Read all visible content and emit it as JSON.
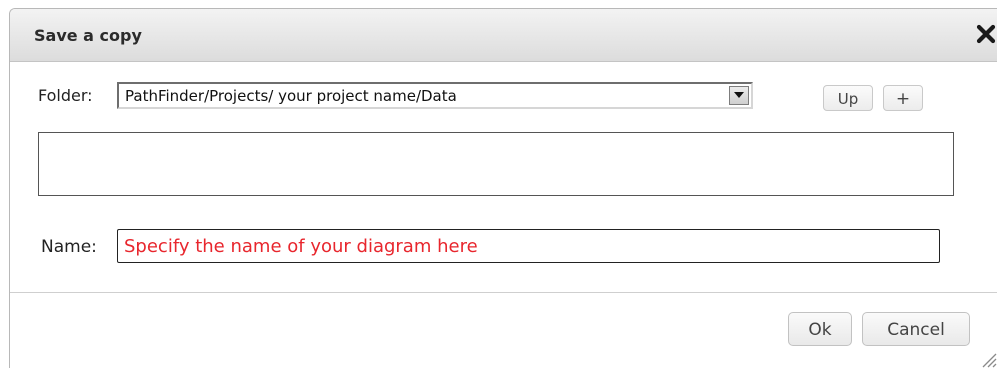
{
  "dialog": {
    "title": "Save a copy",
    "close_icon": "close-icon"
  },
  "folder": {
    "label": "Folder:",
    "selected_value": "PathFinder/Projects/ your project name/Data",
    "up_label": "Up",
    "add_label": "+"
  },
  "name": {
    "label": "Name:",
    "value": "",
    "placeholder": "Specify the name of your diagram here",
    "placeholder_color": "#e8262d"
  },
  "footer": {
    "ok_label": "Ok",
    "cancel_label": "Cancel"
  }
}
